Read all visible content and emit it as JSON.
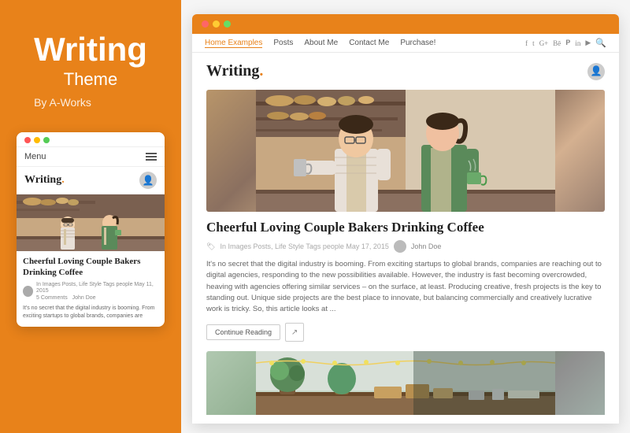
{
  "leftPanel": {
    "title": "Writing",
    "subtitle": "Theme",
    "byLine": "By A-Works"
  },
  "mobilePreview": {
    "dots": [
      "red",
      "yellow",
      "green"
    ],
    "menuLabel": "Menu",
    "logoText": "Writing",
    "logoDot": ".",
    "postTitle": "Cheerful Loving Couple Bakers Drinking Coffee",
    "metaLine1": "In Images Posts, Life Style  Tags people  May 11, 2015",
    "comments": "5 Comments",
    "authorName": "John Doe",
    "bodyText": "It's no secret that the digital industry is booming. From exciting startups to global brands, companies are"
  },
  "desktopPreview": {
    "dots": [
      "red",
      "yellow",
      "green"
    ],
    "navLinks": [
      {
        "label": "Home Examples",
        "active": true
      },
      {
        "label": "Posts"
      },
      {
        "label": "About Me"
      },
      {
        "label": "Contact Me"
      },
      {
        "label": "Purchase!"
      }
    ],
    "navIcons": [
      "f",
      "t",
      "g+",
      "be",
      "p",
      "in",
      "yt"
    ],
    "logoText": "Writing",
    "logoDot": ".",
    "mainPost": {
      "title": "Cheerful Loving Couple Bakers Drinking Coffee",
      "metaCategoryIcon": "🏷",
      "metaText": "In  Images Posts, Life Style  Tags people  May 17, 2015",
      "authorName": "John Doe",
      "bodyText": "It's no secret that the digital industry is booming. From exciting startups to global brands, companies are reaching out to digital agencies, responding to the new possibilities available. However, the industry is fast becoming overcrowded, heaving with agencies offering similar services – on the surface, at least. Producing creative, fresh projects is the key to standing out. Unique side projects are the best place to innovate, but balancing commercially and creatively lucrative work is tricky. So, this article looks at ...",
      "continueReading": "Continue Reading"
    }
  }
}
